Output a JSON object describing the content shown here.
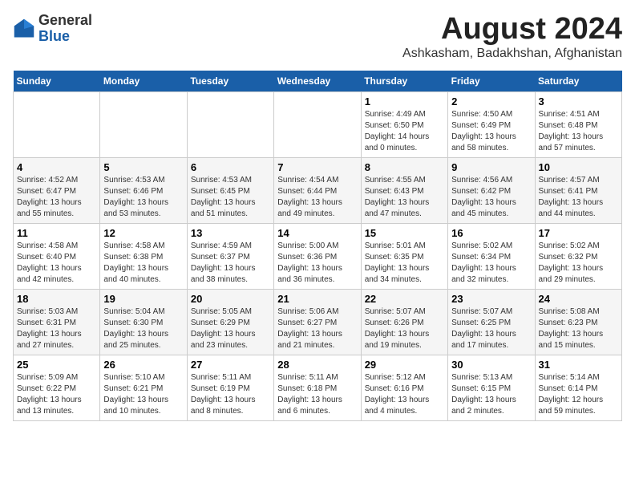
{
  "header": {
    "logo_line1": "General",
    "logo_line2": "Blue",
    "main_title": "August 2024",
    "sub_title": "Ashkasham, Badakhshan, Afghanistan"
  },
  "calendar": {
    "days_of_week": [
      "Sunday",
      "Monday",
      "Tuesday",
      "Wednesday",
      "Thursday",
      "Friday",
      "Saturday"
    ],
    "weeks": [
      [
        {
          "day": "",
          "info": ""
        },
        {
          "day": "",
          "info": ""
        },
        {
          "day": "",
          "info": ""
        },
        {
          "day": "",
          "info": ""
        },
        {
          "day": "1",
          "info": "Sunrise: 4:49 AM\nSunset: 6:50 PM\nDaylight: 14 hours\nand 0 minutes."
        },
        {
          "day": "2",
          "info": "Sunrise: 4:50 AM\nSunset: 6:49 PM\nDaylight: 13 hours\nand 58 minutes."
        },
        {
          "day": "3",
          "info": "Sunrise: 4:51 AM\nSunset: 6:48 PM\nDaylight: 13 hours\nand 57 minutes."
        }
      ],
      [
        {
          "day": "4",
          "info": "Sunrise: 4:52 AM\nSunset: 6:47 PM\nDaylight: 13 hours\nand 55 minutes."
        },
        {
          "day": "5",
          "info": "Sunrise: 4:53 AM\nSunset: 6:46 PM\nDaylight: 13 hours\nand 53 minutes."
        },
        {
          "day": "6",
          "info": "Sunrise: 4:53 AM\nSunset: 6:45 PM\nDaylight: 13 hours\nand 51 minutes."
        },
        {
          "day": "7",
          "info": "Sunrise: 4:54 AM\nSunset: 6:44 PM\nDaylight: 13 hours\nand 49 minutes."
        },
        {
          "day": "8",
          "info": "Sunrise: 4:55 AM\nSunset: 6:43 PM\nDaylight: 13 hours\nand 47 minutes."
        },
        {
          "day": "9",
          "info": "Sunrise: 4:56 AM\nSunset: 6:42 PM\nDaylight: 13 hours\nand 45 minutes."
        },
        {
          "day": "10",
          "info": "Sunrise: 4:57 AM\nSunset: 6:41 PM\nDaylight: 13 hours\nand 44 minutes."
        }
      ],
      [
        {
          "day": "11",
          "info": "Sunrise: 4:58 AM\nSunset: 6:40 PM\nDaylight: 13 hours\nand 42 minutes."
        },
        {
          "day": "12",
          "info": "Sunrise: 4:58 AM\nSunset: 6:38 PM\nDaylight: 13 hours\nand 40 minutes."
        },
        {
          "day": "13",
          "info": "Sunrise: 4:59 AM\nSunset: 6:37 PM\nDaylight: 13 hours\nand 38 minutes."
        },
        {
          "day": "14",
          "info": "Sunrise: 5:00 AM\nSunset: 6:36 PM\nDaylight: 13 hours\nand 36 minutes."
        },
        {
          "day": "15",
          "info": "Sunrise: 5:01 AM\nSunset: 6:35 PM\nDaylight: 13 hours\nand 34 minutes."
        },
        {
          "day": "16",
          "info": "Sunrise: 5:02 AM\nSunset: 6:34 PM\nDaylight: 13 hours\nand 32 minutes."
        },
        {
          "day": "17",
          "info": "Sunrise: 5:02 AM\nSunset: 6:32 PM\nDaylight: 13 hours\nand 29 minutes."
        }
      ],
      [
        {
          "day": "18",
          "info": "Sunrise: 5:03 AM\nSunset: 6:31 PM\nDaylight: 13 hours\nand 27 minutes."
        },
        {
          "day": "19",
          "info": "Sunrise: 5:04 AM\nSunset: 6:30 PM\nDaylight: 13 hours\nand 25 minutes."
        },
        {
          "day": "20",
          "info": "Sunrise: 5:05 AM\nSunset: 6:29 PM\nDaylight: 13 hours\nand 23 minutes."
        },
        {
          "day": "21",
          "info": "Sunrise: 5:06 AM\nSunset: 6:27 PM\nDaylight: 13 hours\nand 21 minutes."
        },
        {
          "day": "22",
          "info": "Sunrise: 5:07 AM\nSunset: 6:26 PM\nDaylight: 13 hours\nand 19 minutes."
        },
        {
          "day": "23",
          "info": "Sunrise: 5:07 AM\nSunset: 6:25 PM\nDaylight: 13 hours\nand 17 minutes."
        },
        {
          "day": "24",
          "info": "Sunrise: 5:08 AM\nSunset: 6:23 PM\nDaylight: 13 hours\nand 15 minutes."
        }
      ],
      [
        {
          "day": "25",
          "info": "Sunrise: 5:09 AM\nSunset: 6:22 PM\nDaylight: 13 hours\nand 13 minutes."
        },
        {
          "day": "26",
          "info": "Sunrise: 5:10 AM\nSunset: 6:21 PM\nDaylight: 13 hours\nand 10 minutes."
        },
        {
          "day": "27",
          "info": "Sunrise: 5:11 AM\nSunset: 6:19 PM\nDaylight: 13 hours\nand 8 minutes."
        },
        {
          "day": "28",
          "info": "Sunrise: 5:11 AM\nSunset: 6:18 PM\nDaylight: 13 hours\nand 6 minutes."
        },
        {
          "day": "29",
          "info": "Sunrise: 5:12 AM\nSunset: 6:16 PM\nDaylight: 13 hours\nand 4 minutes."
        },
        {
          "day": "30",
          "info": "Sunrise: 5:13 AM\nSunset: 6:15 PM\nDaylight: 13 hours\nand 2 minutes."
        },
        {
          "day": "31",
          "info": "Sunrise: 5:14 AM\nSunset: 6:14 PM\nDaylight: 12 hours\nand 59 minutes."
        }
      ]
    ]
  }
}
